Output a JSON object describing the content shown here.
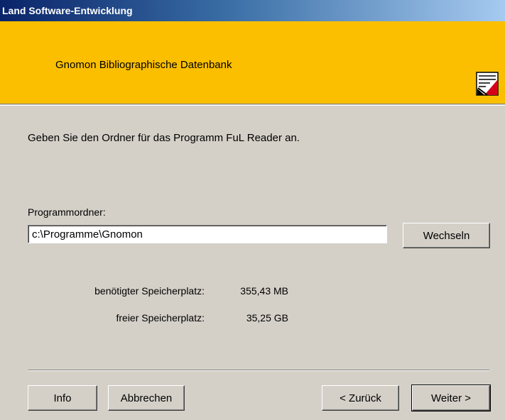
{
  "window": {
    "title": "Land Software-Entwicklung"
  },
  "banner": {
    "title": "Gnomon Bibliographische Datenbank",
    "logo_icon": "gnomon-logo-icon"
  },
  "instruction": "Geben Sie den Ordner für das Programm FuL Reader an.",
  "folder": {
    "label": "Programmordner:",
    "value": "c:\\Programme\\Gnomon",
    "change_button": "Wechseln"
  },
  "space": {
    "required_label": "benötigter Speicherplatz:",
    "required_value": "355,43 MB",
    "free_label": "freier Speicherplatz:",
    "free_value": "35,25 GB"
  },
  "buttons": {
    "info": "Info",
    "cancel": "Abbrechen",
    "back": "< Zurück",
    "next": "Weiter >"
  },
  "colors": {
    "banner": "#fbbf00",
    "dialog": "#d4d0c8"
  }
}
